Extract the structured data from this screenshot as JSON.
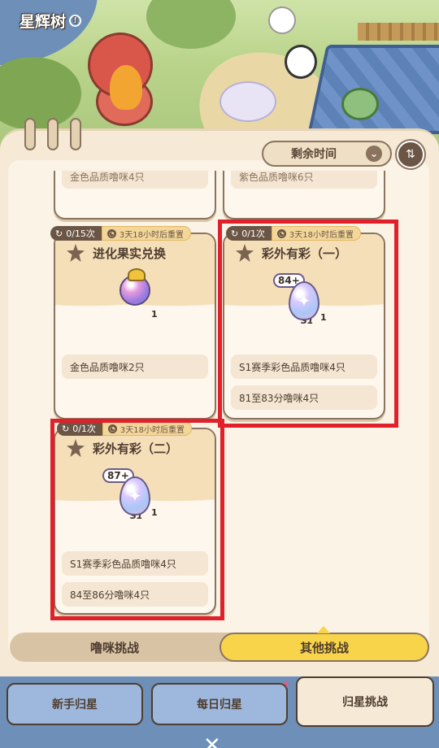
{
  "app": {
    "title": "星辉树"
  },
  "toolbar": {
    "timer_label": "剩余时间"
  },
  "cards": [
    {
      "id": "card-evolution-exchange",
      "counter": "0/15次",
      "reset": "3天18小时后重置",
      "title": "进化果实兑换",
      "reward": {
        "icon": "evolution-fruit-icon",
        "quantity": "1"
      },
      "requirements": [
        "金色品质噜咪2只"
      ]
    },
    {
      "id": "card-colorful-1",
      "counter": "0/1次",
      "reset": "3天18小时后重置",
      "title": "彩外有彩（一）",
      "reward": {
        "icon": "season-egg-icon",
        "level": "84+",
        "season": "S1",
        "quantity": "1"
      },
      "requirements": [
        "S1赛季彩色品质噜咪4只",
        "81至83分噜咪4只"
      ]
    },
    {
      "id": "card-colorful-2",
      "counter": "0/1次",
      "reset": "3天18小时后重置",
      "title": "彩外有彩（二）",
      "reward": {
        "icon": "season-egg-icon",
        "level": "87+",
        "season": "S1",
        "quantity": "1"
      },
      "requirements": [
        "S1赛季彩色品质噜咪4只",
        "84至86分噜咪4只"
      ]
    }
  ],
  "top_cards_partial": [
    "金色品质噜咪4只",
    "紫色品质噜咪6只"
  ],
  "segment": {
    "left": "噜咪挑战",
    "right": "其他挑战",
    "active": "right"
  },
  "tabs": [
    {
      "label": "新手归星",
      "active": false
    },
    {
      "label": "每日归星",
      "active": false,
      "badge": true
    },
    {
      "label": "归星挑战",
      "active": true
    }
  ],
  "colors": {
    "highlight": "#e0202a",
    "accent": "#f7d44a",
    "panel": "#f6ead7"
  }
}
